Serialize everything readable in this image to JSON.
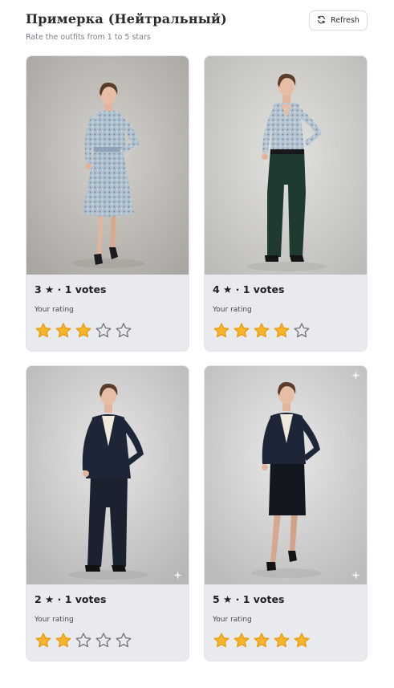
{
  "header": {
    "title": "Примерка (Нейтральный)",
    "subtitle": "Rate the outfits from 1 to 5 stars",
    "refresh_label": "Refresh",
    "refresh_icon": "refresh-icon"
  },
  "colors": {
    "star_filled": "#f6b52b",
    "star_outline": "#6b7078",
    "card_bg": "#e9eaee"
  },
  "cards": [
    {
      "average": "3",
      "votes_text": "1 votes",
      "rating_label": "Your rating",
      "user_rating": 3,
      "max_rating": 5,
      "outfit": "floral-midi-dress"
    },
    {
      "average": "4",
      "votes_text": "1 votes",
      "rating_label": "Your rating",
      "user_rating": 4,
      "max_rating": 5,
      "outfit": "floral-blouse-green-trousers"
    },
    {
      "average": "2",
      "votes_text": "1 votes",
      "rating_label": "Your rating",
      "user_rating": 2,
      "max_rating": 5,
      "outfit": "navy-trouser-suit"
    },
    {
      "average": "5",
      "votes_text": "1 votes",
      "rating_label": "Your rating",
      "user_rating": 5,
      "max_rating": 5,
      "outfit": "navy-skirt-suit"
    }
  ]
}
